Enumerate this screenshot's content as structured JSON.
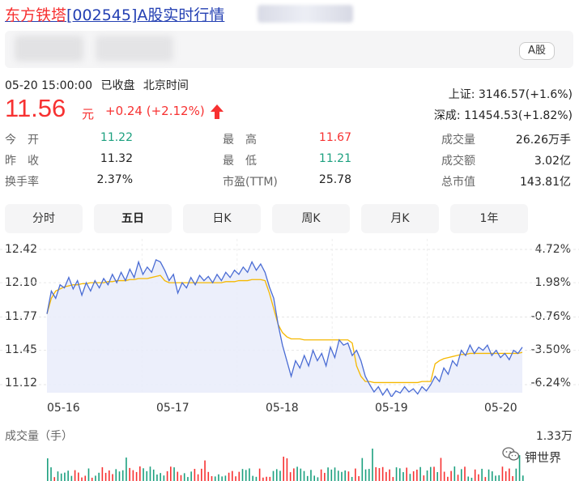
{
  "header": {
    "title_name": "东方铁塔",
    "title_code": "[002545]",
    "title_rest": "A股实时行情"
  },
  "badge": "A股",
  "status": {
    "datetime": "05-20 15:00:00",
    "state": "已收盘",
    "zone": "北京时间"
  },
  "quote": {
    "price": "11.56",
    "unit": "元",
    "change": "+0.24",
    "change_pct": "(+2.12%)"
  },
  "indices": [
    {
      "name": "上证:",
      "value": "3146.57(+1.6%)"
    },
    {
      "name": "深成:",
      "value": "11454.53(+1.82%)"
    }
  ],
  "stats": [
    {
      "label": "今　开",
      "value": "11.22",
      "color": "green"
    },
    {
      "label": "昨　收",
      "value": "11.32",
      "color": "normal"
    },
    {
      "label": "换手率",
      "value": "2.37%",
      "color": "normal"
    },
    {
      "label": "最　高",
      "value": "11.67",
      "color": "red"
    },
    {
      "label": "最　低",
      "value": "11.21",
      "color": "green"
    },
    {
      "label": "市盈(TTM)",
      "value": "25.78",
      "color": "normal"
    },
    {
      "label": "成交量",
      "value": "26.26万手",
      "color": "normal"
    },
    {
      "label": "成交额",
      "value": "3.02亿",
      "color": "normal"
    },
    {
      "label": "总市值",
      "value": "143.81亿",
      "color": "normal"
    }
  ],
  "tabs": [
    "分时",
    "五日",
    "日K",
    "周K",
    "月K",
    "1年"
  ],
  "active_tab": "五日",
  "colors": {
    "up": "#f73131",
    "down": "#1ca07f",
    "price_line": "#4a6cd4",
    "avg_line": "#f5b800",
    "fill": "#e9ecfa"
  },
  "chart_data": {
    "type": "line",
    "x_labels": [
      "05-16",
      "05-17",
      "05-18",
      "05-19",
      "05-20"
    ],
    "y_ticks": [
      "12.42",
      "12.10",
      "11.77",
      "11.45",
      "11.12"
    ],
    "y_pct_ticks": [
      "4.72%",
      "1.98%",
      "-0.76%",
      "-3.50%",
      "-6.24%"
    ],
    "ylim": [
      11.12,
      12.42
    ],
    "series": [
      {
        "values": [
          11.8,
          12.02,
          11.95,
          12.08,
          12.05,
          12.15,
          12.04,
          12.12,
          11.98,
          12.1,
          12.02,
          12.12,
          12.05,
          12.14,
          12.08,
          12.18,
          12.1,
          12.2,
          12.12,
          12.23,
          12.15,
          12.3,
          12.18,
          12.25,
          12.2,
          12.32,
          12.3,
          12.22,
          12.12,
          12.18,
          12.0,
          12.1,
          12.05,
          12.15,
          12.08,
          12.17,
          12.12,
          12.16,
          12.1,
          12.18,
          12.12,
          12.2,
          12.15,
          12.22,
          12.18,
          12.25,
          12.2,
          12.3,
          12.22,
          12.28,
          12.2,
          12.06,
          11.95,
          11.7,
          11.5,
          11.35,
          11.2,
          11.35,
          11.28,
          11.4,
          11.3,
          11.45,
          11.35,
          11.42,
          11.3,
          11.48,
          11.38,
          11.55,
          11.5,
          11.52,
          11.4,
          11.45,
          11.35,
          11.2,
          11.12,
          11.05,
          11.1,
          11.02,
          11.08,
          11.0,
          11.06,
          11.04,
          11.1,
          11.05,
          11.08,
          11.03,
          11.1,
          11.06,
          11.12,
          11.2,
          11.15,
          11.28,
          11.22,
          11.35,
          11.3,
          11.45,
          11.4,
          11.5,
          11.42,
          11.48,
          11.45,
          11.5,
          11.4,
          11.45,
          11.38,
          11.42,
          11.36,
          11.45,
          11.42,
          11.48
        ],
        "color": "#4a6cd4"
      },
      {
        "values": [
          11.8,
          11.95,
          12.02,
          12.04,
          12.06,
          12.07,
          12.08,
          12.08,
          12.09,
          12.09,
          12.1,
          12.1,
          12.1,
          12.1,
          12.11,
          12.11,
          12.12,
          12.12,
          12.12,
          12.13,
          12.13,
          12.14,
          12.14,
          12.14,
          12.15,
          12.16,
          12.17,
          12.12,
          12.1,
          12.1,
          12.1,
          12.1,
          12.1,
          12.1,
          12.1,
          12.1,
          12.1,
          12.1,
          12.1,
          12.1,
          12.1,
          12.11,
          12.11,
          12.11,
          12.12,
          12.12,
          12.12,
          12.13,
          12.13,
          12.13,
          12.12,
          12.0,
          11.85,
          11.7,
          11.62,
          11.58,
          11.56,
          11.56,
          11.56,
          11.55,
          11.55,
          11.55,
          11.55,
          11.55,
          11.55,
          11.55,
          11.55,
          11.55,
          11.55,
          11.55,
          11.52,
          11.3,
          11.2,
          11.15,
          11.15,
          11.14,
          11.14,
          11.14,
          11.14,
          11.14,
          11.14,
          11.14,
          11.14,
          11.14,
          11.14,
          11.14,
          11.15,
          11.15,
          11.15,
          11.32,
          11.35,
          11.37,
          11.38,
          11.39,
          11.4,
          11.41,
          11.41,
          11.42,
          11.42,
          11.42,
          11.42,
          11.42,
          11.42,
          11.42,
          11.42,
          11.42,
          11.42,
          11.42,
          11.42,
          11.43
        ],
        "color": "#f5b800"
      }
    ],
    "volume_title": "成交量（手）",
    "volume_max": "1.33万"
  },
  "watermark": "钾世界"
}
